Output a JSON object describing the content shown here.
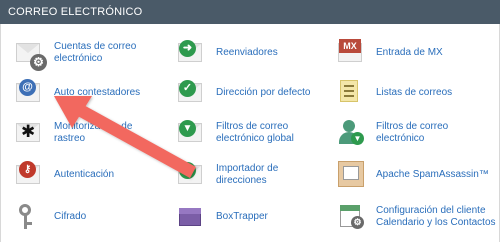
{
  "header": {
    "title": "CORREO ELECTRÓNICO"
  },
  "items": [
    {
      "label": "Cuentas de correo electrónico",
      "icon": "gear-envelope-icon"
    },
    {
      "label": "Reenviadores",
      "icon": "forward-arrow-icon"
    },
    {
      "label": "Entrada de MX",
      "icon": "mx-icon"
    },
    {
      "label": "Auto contestadores",
      "icon": "at-sign-icon"
    },
    {
      "label": "Dirección por defecto",
      "icon": "checkmark-icon"
    },
    {
      "label": "Listas de correos",
      "icon": "list-icon"
    },
    {
      "label": "Monitorización de rastreo",
      "icon": "paw-icon"
    },
    {
      "label": "Filtros de correo electrónico global",
      "icon": "funnel-icon"
    },
    {
      "label": "Filtros de correo electrónico",
      "icon": "user-filter-icon"
    },
    {
      "label": "Autenticación",
      "icon": "key-icon"
    },
    {
      "label": "Importador de direcciones",
      "icon": "import-arrow-icon"
    },
    {
      "label": "Apache SpamAssassin™",
      "icon": "spam-icon"
    },
    {
      "label": "Cifrado",
      "icon": "keys-icon"
    },
    {
      "label": "BoxTrapper",
      "icon": "box-icon"
    },
    {
      "label": "Configuración del cliente Calendario y los Contactos",
      "icon": "calendar-icon"
    }
  ],
  "colors": {
    "header_bg": "#4a5a68",
    "link": "#2a6ebb",
    "arrow": "#f2675f"
  }
}
